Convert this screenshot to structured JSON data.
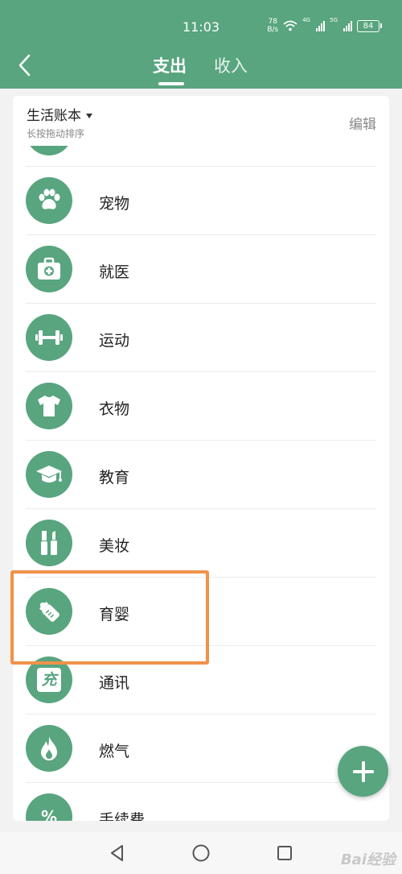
{
  "status": {
    "time": "11:03",
    "net_speed_value": "78",
    "net_speed_unit": "B/s",
    "network_1": "4G",
    "network_2": "5G",
    "battery": "84"
  },
  "header": {
    "tabs": [
      {
        "label": "支出",
        "active": true
      },
      {
        "label": "收入",
        "active": false
      }
    ],
    "back_icon": "chevron-left-icon"
  },
  "book": {
    "title": "生活账本",
    "hint": "长按拖动排序",
    "edit_label": "编辑"
  },
  "categories": [
    {
      "label": "宠物",
      "icon": "paw-icon"
    },
    {
      "label": "就医",
      "icon": "medical-kit-icon"
    },
    {
      "label": "运动",
      "icon": "dumbbell-icon"
    },
    {
      "label": "衣物",
      "icon": "shirt-icon"
    },
    {
      "label": "教育",
      "icon": "graduation-cap-icon"
    },
    {
      "label": "美妆",
      "icon": "makeup-icon"
    },
    {
      "label": "育婴",
      "icon": "baby-bottle-icon"
    },
    {
      "label": "通讯",
      "icon": "recharge-icon"
    },
    {
      "label": "燃气",
      "icon": "flame-icon"
    },
    {
      "label": "手续费",
      "icon": "percent-icon"
    }
  ],
  "fab_icon": "plus-icon",
  "icon_text": {
    "recharge": "充",
    "percent": "%"
  },
  "watermark": "Bai经验",
  "colors": {
    "primary": "#58a57f",
    "highlight": "#f0924a"
  }
}
